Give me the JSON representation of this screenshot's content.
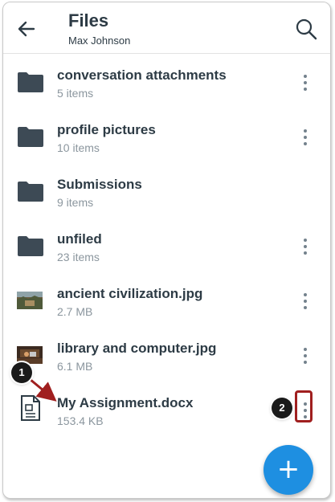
{
  "header": {
    "title": "Files",
    "subtitle": "Max Johnson",
    "back_icon": "arrow-left-icon",
    "search_icon": "search-icon"
  },
  "files": [
    {
      "name": "conversation attachments",
      "meta": "5 items",
      "kind": "folder",
      "has_menu": true
    },
    {
      "name": "profile pictures",
      "meta": "10 items",
      "kind": "folder",
      "has_menu": true
    },
    {
      "name": "Submissions",
      "meta": "9 items",
      "kind": "folder",
      "has_menu": false
    },
    {
      "name": "unfiled",
      "meta": "23 items",
      "kind": "folder",
      "has_menu": true
    },
    {
      "name": "ancient civilization.jpg",
      "meta": "2.7 MB",
      "kind": "image",
      "has_menu": true
    },
    {
      "name": "library and computer.jpg",
      "meta": "6.1 MB",
      "kind": "image",
      "has_menu": true
    },
    {
      "name": "My Assignment.docx",
      "meta": "153.4 KB",
      "kind": "document",
      "has_menu": true
    }
  ],
  "fab": {
    "label": "+"
  },
  "callouts": [
    "1",
    "2"
  ],
  "colors": {
    "text_primary": "#2d3b45",
    "text_secondary": "#8b969e",
    "folder": "#3d4a55",
    "fab": "#1e8fe1",
    "callout_highlight": "#a01f1f"
  }
}
